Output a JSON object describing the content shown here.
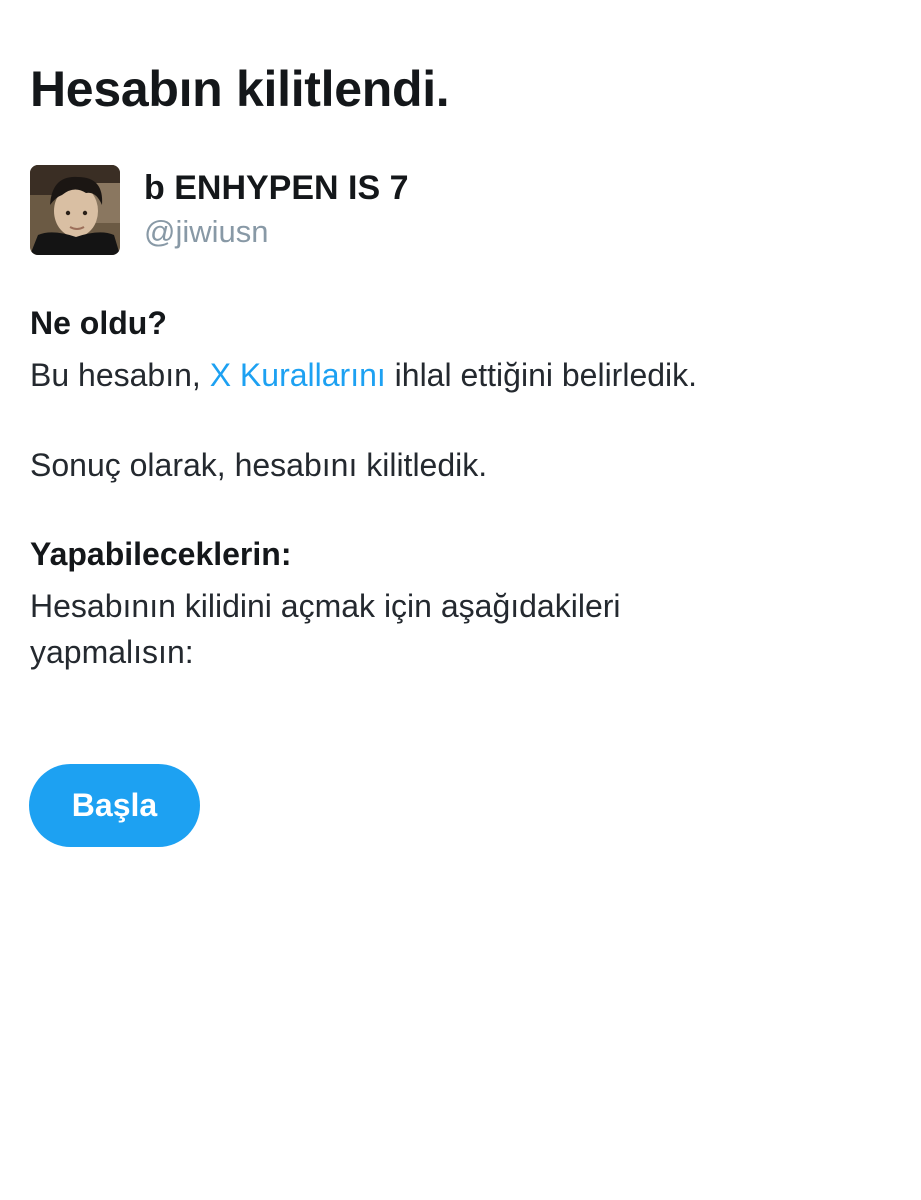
{
  "page": {
    "title": "Hesabın kilitlendi."
  },
  "account": {
    "display_name": "b ENHYPEN IS 7",
    "handle": "@jiwiusn",
    "avatar_icon": "profile-photo"
  },
  "what_happened": {
    "heading": "Ne oldu?",
    "text_before_link": "Bu hesabın, ",
    "link_label": "X Kurallarını",
    "text_after_link": " ihlal ettiğini belirledik.",
    "result_text": "Sonuç olarak, hesabını kilitledik."
  },
  "what_you_can_do": {
    "heading": "Yapabileceklerin:",
    "text": "Hesabının kilidini açmak için aşağıdakileri yapmalısın:"
  },
  "actions": {
    "start_label": "Başla"
  },
  "colors": {
    "accent": "#1da1f2",
    "title": "#14171a",
    "secondary": "#8899a6"
  }
}
